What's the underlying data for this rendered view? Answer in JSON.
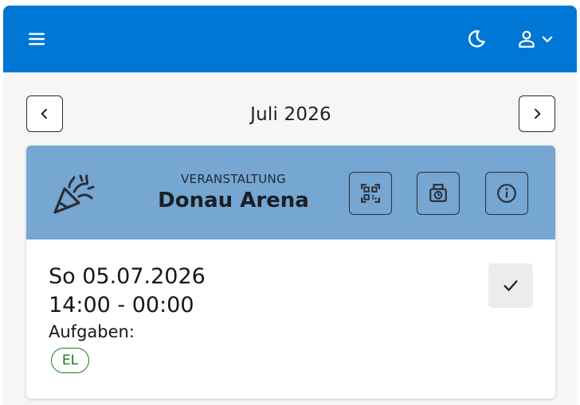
{
  "header": {
    "icons": {
      "menu": "hamburger-menu-icon",
      "theme": "moon-icon",
      "user": "user-icon",
      "user_dropdown": "chevron-down-icon"
    },
    "background_color": "#0077d4"
  },
  "month_nav": {
    "label": "Juli 2026",
    "prev_icon": "chevron-left-icon",
    "next_icon": "chevron-right-icon"
  },
  "event": {
    "type": "VERANSTALTUNG",
    "name": "Donau Arena",
    "header_color": "#76a6d2",
    "icons": {
      "event": "party-popper-icon",
      "qr": "qr-code-icon",
      "print": "print-timer-icon",
      "info": "info-icon"
    },
    "date": "So 05.07.2026",
    "time": "14:00 - 00:00",
    "tasks_label": "Aufgaben:",
    "tasks": [
      "EL"
    ],
    "task_color": "#1b7a1b",
    "confirm_icon": "checkmark-icon"
  }
}
